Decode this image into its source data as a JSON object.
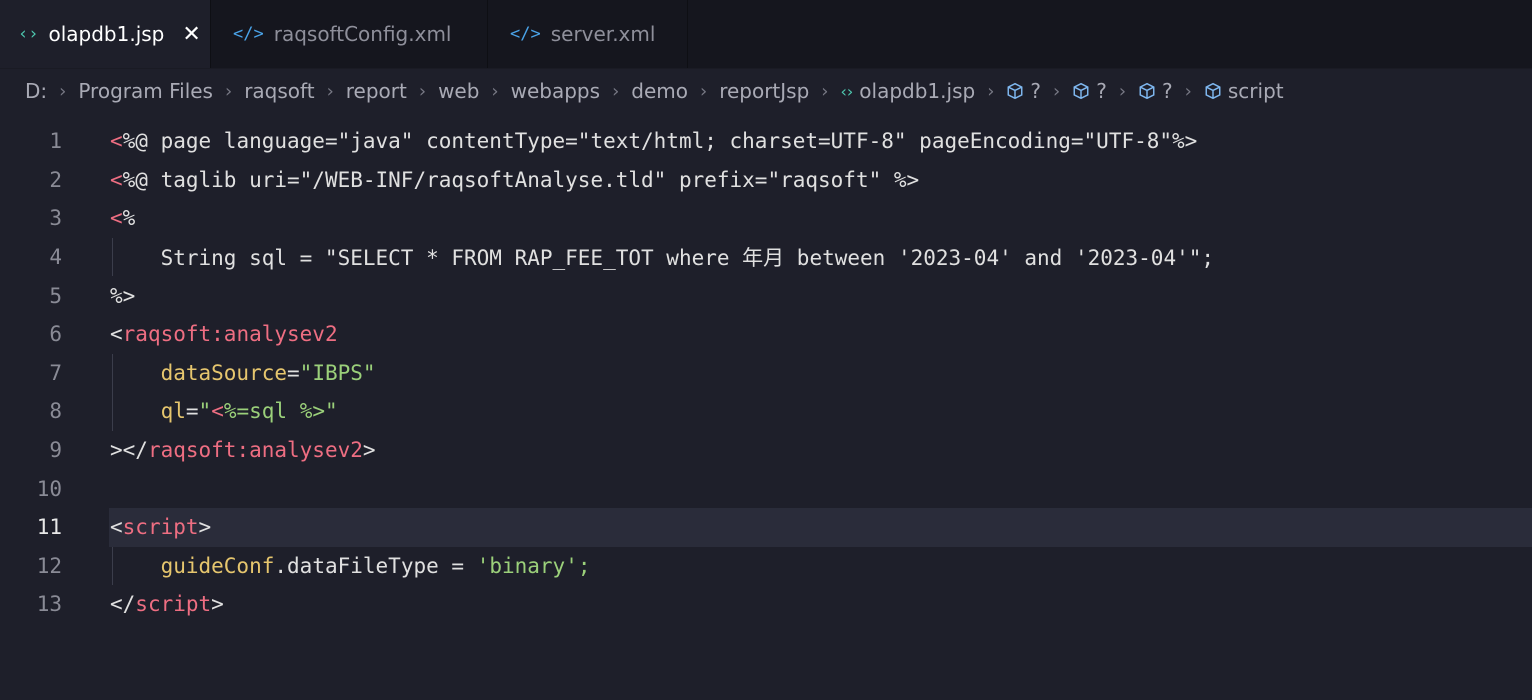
{
  "tabs": [
    {
      "icon": "‹›",
      "label": "olapdb1.jsp",
      "active": true,
      "close": "✕"
    },
    {
      "icon": "</>",
      "label": "raqsoftConfig.xml",
      "active": false
    },
    {
      "icon": "</>",
      "label": "server.xml",
      "active": false,
      "modified": true
    }
  ],
  "breadcrumb": {
    "items": [
      "D:",
      "Program Files",
      "raqsoft",
      "report",
      "web",
      "webapps",
      "demo",
      "reportJsp",
      "olapdb1.jsp",
      "?",
      "?",
      "?",
      "script"
    ],
    "separator": "›"
  },
  "editor": {
    "current_line": 11,
    "lines": [
      {
        "n": "1",
        "tokens": [
          [
            "tag",
            "<"
          ],
          [
            "plain",
            "%@ page language=\"java\" contentType=\"text/html; charset=UTF-8\" pageEncoding=\"UTF-8\"%>"
          ]
        ]
      },
      {
        "n": "2",
        "tokens": [
          [
            "tag",
            "<"
          ],
          [
            "plain",
            "%@ taglib uri=\"/WEB-INF/raqsoftAnalyse.tld\" prefix=\"raqsoft\" %>"
          ]
        ]
      },
      {
        "n": "3",
        "tokens": [
          [
            "tag",
            "<"
          ],
          [
            "plain",
            "%"
          ]
        ]
      },
      {
        "n": "4",
        "tokens": [
          [
            "plain",
            "    String sql = \"SELECT * FROM RAP_FEE_TOT where 年月 between '2023-04' and '2023-04'\";"
          ]
        ]
      },
      {
        "n": "5",
        "tokens": [
          [
            "plain",
            "%>"
          ]
        ]
      },
      {
        "n": "6",
        "tokens": [
          [
            "punc",
            "<"
          ],
          [
            "tag",
            "raqsoft:analysev2"
          ]
        ]
      },
      {
        "n": "7",
        "tokens": [
          [
            "plain",
            "    "
          ],
          [
            "attr",
            "dataSource"
          ],
          [
            "punc",
            "="
          ],
          [
            "str",
            "\"IBPS\""
          ]
        ]
      },
      {
        "n": "8",
        "tokens": [
          [
            "plain",
            "    "
          ],
          [
            "attr",
            "ql"
          ],
          [
            "punc",
            "="
          ],
          [
            "str",
            "\""
          ],
          [
            "tag",
            "<"
          ],
          [
            "str",
            "%=sql %>\""
          ]
        ]
      },
      {
        "n": "9",
        "tokens": [
          [
            "punc",
            "></"
          ],
          [
            "tag",
            "raqsoft:analysev2"
          ],
          [
            "punc",
            ">"
          ]
        ]
      },
      {
        "n": "10",
        "tokens": []
      },
      {
        "n": "11",
        "tokens": [
          [
            "punc",
            "<"
          ],
          [
            "tag",
            "script"
          ],
          [
            "punc",
            ">"
          ]
        ]
      },
      {
        "n": "12",
        "tokens": [
          [
            "plain",
            "    "
          ],
          [
            "attr",
            "guideConf"
          ],
          [
            "punc",
            "."
          ],
          [
            "plain",
            "dataFileType = "
          ],
          [
            "str",
            "'binary';"
          ]
        ]
      },
      {
        "n": "13",
        "tokens": [
          [
            "punc",
            "</"
          ],
          [
            "tag",
            "script"
          ],
          [
            "punc",
            ">"
          ]
        ]
      }
    ]
  }
}
